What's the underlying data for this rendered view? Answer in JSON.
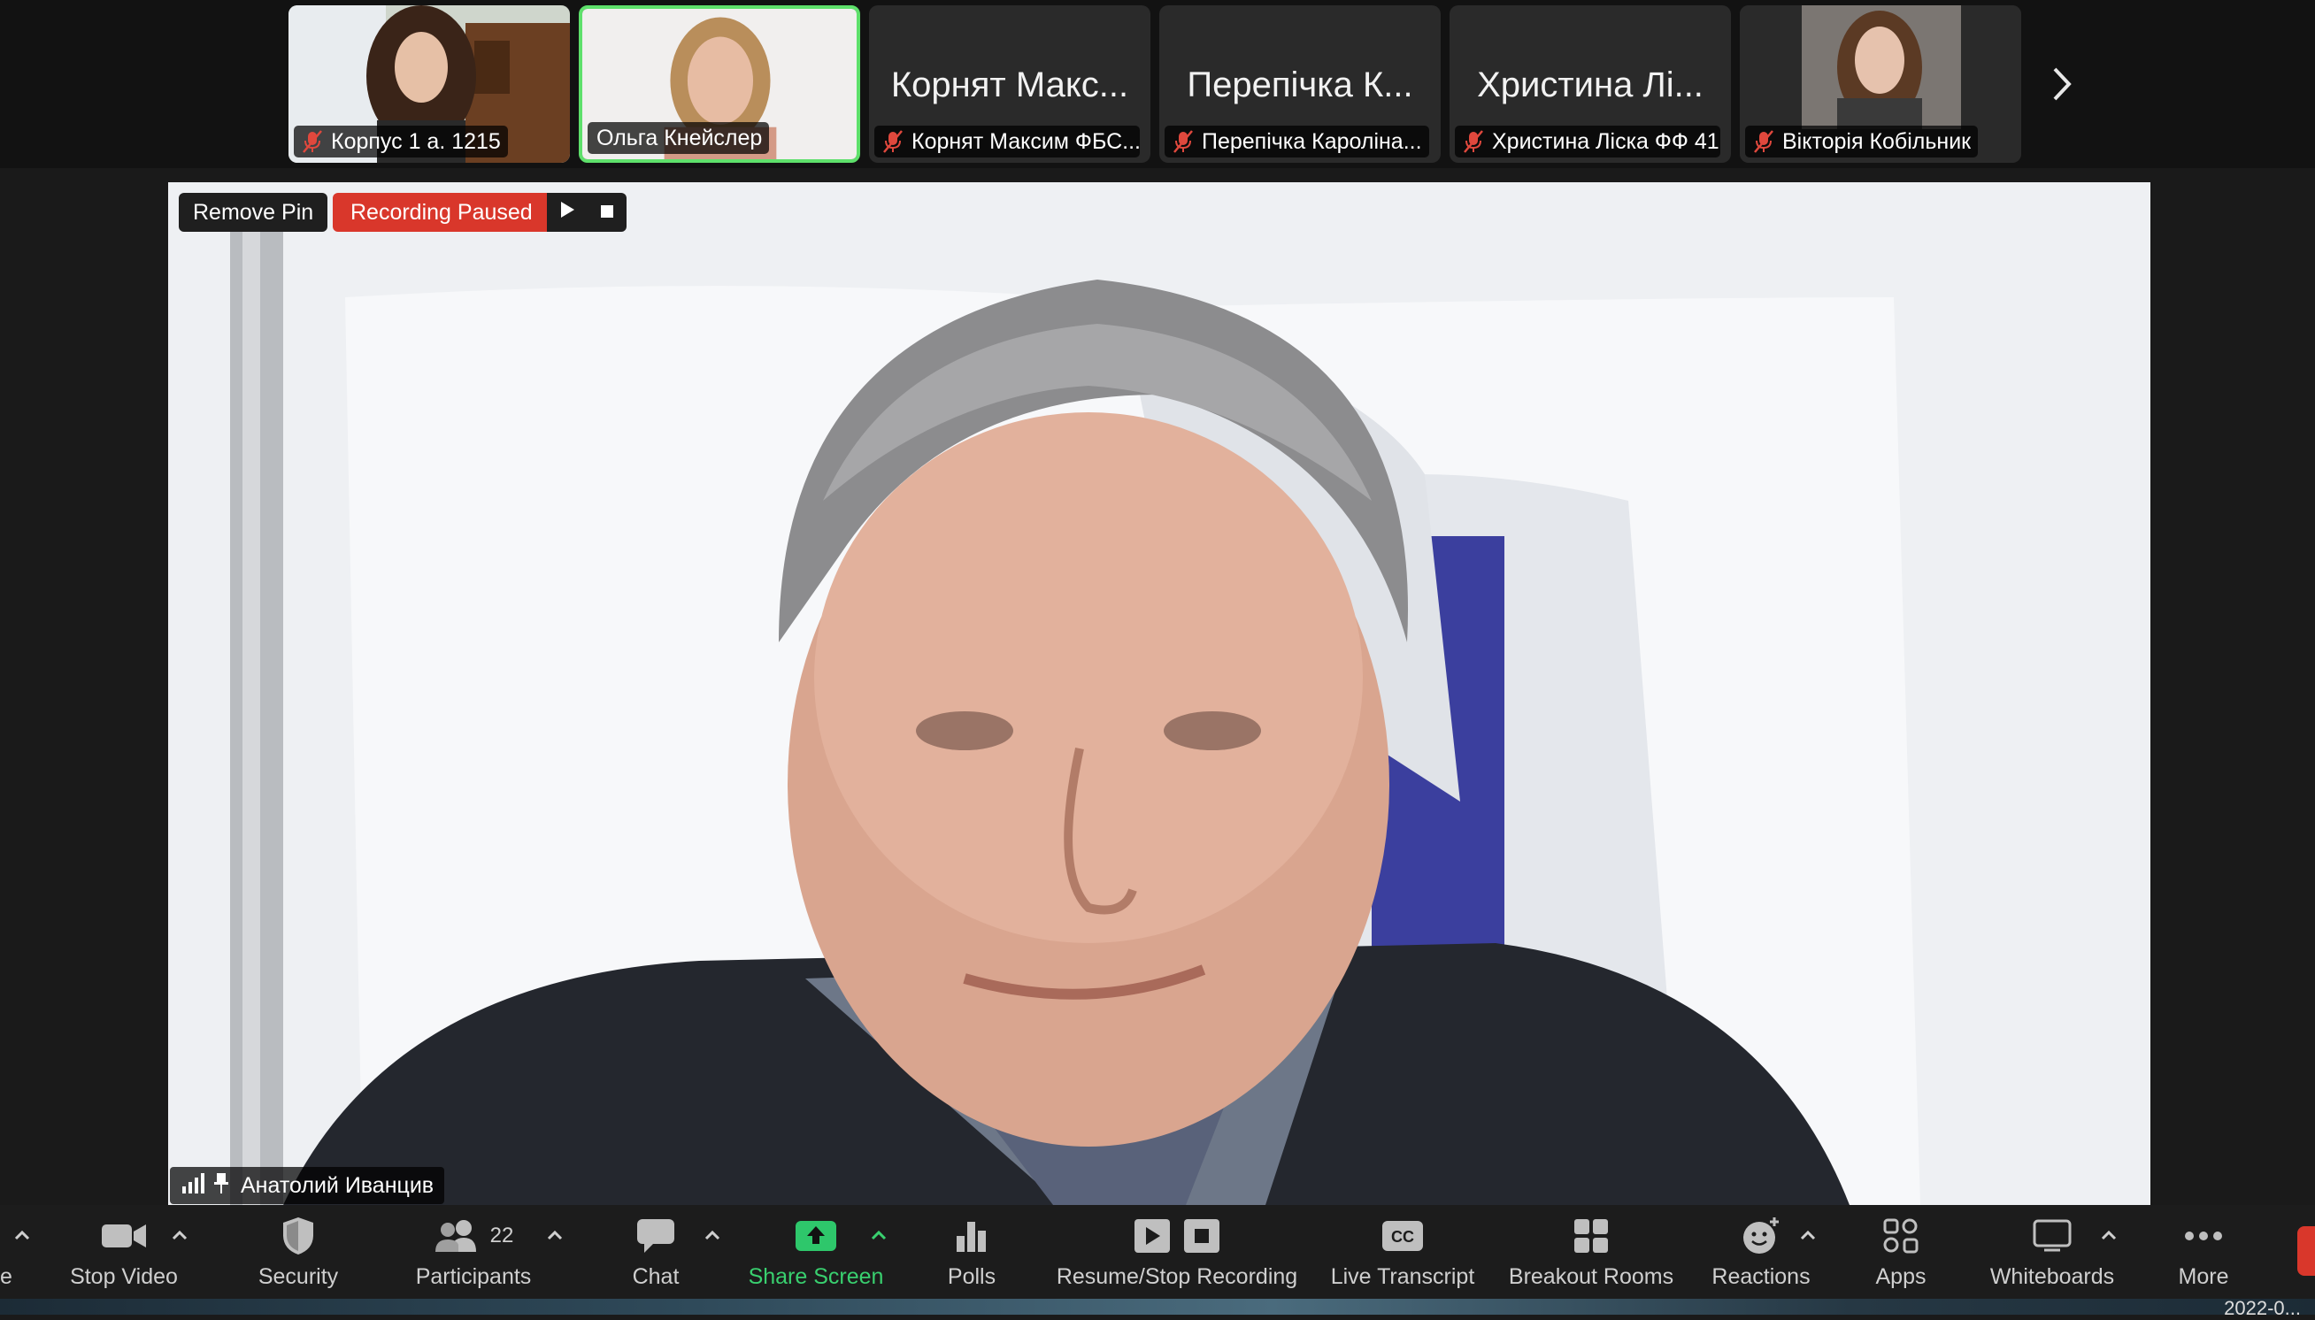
{
  "participants_strip": [
    {
      "name": "Корпус 1 а. 1215",
      "muted": true,
      "video": true
    },
    {
      "name": "Ольга Кнейслер",
      "muted": false,
      "video": true,
      "active": true
    },
    {
      "big_name": "Корнят Макс...",
      "name": "Корнят Максим ФБС...",
      "muted": true,
      "video": false
    },
    {
      "big_name": "Перепічка К...",
      "name": "Перепічка Кароліна...",
      "muted": true,
      "video": false
    },
    {
      "big_name": "Христина Лі...",
      "name": "Христина Ліска ФФ 41",
      "muted": true,
      "video": false
    },
    {
      "name": "Вікторія Кобільник",
      "muted": true,
      "video": true
    }
  ],
  "main_video": {
    "remove_pin_label": "Remove Pin",
    "recording_status": "Recording Paused",
    "speaker_name": "Анатолий Иванцив"
  },
  "toolbar": {
    "stop_video": "Stop Video",
    "security": "Security",
    "participants": "Participants",
    "participant_count": "22",
    "chat": "Chat",
    "share_screen": "Share Screen",
    "polls": "Polls",
    "recording": "Resume/Stop Recording",
    "live_transcript": "Live Transcript",
    "breakout_rooms": "Breakout Rooms",
    "reactions": "Reactions",
    "apps": "Apps",
    "whiteboards": "Whiteboards",
    "more": "More",
    "left_cut": "e"
  },
  "colors": {
    "active_border": "#5ee06b",
    "share_green": "#2ec76b",
    "recording_red": "#d9372b"
  },
  "date_fragment": "2022-0..."
}
